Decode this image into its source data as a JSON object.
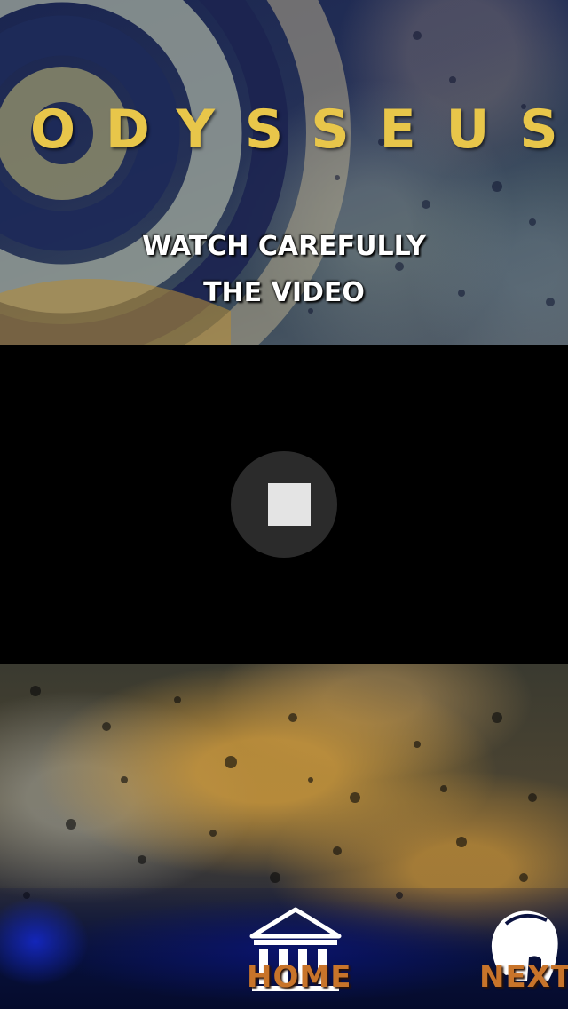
{
  "app": {
    "title": "ODYSSEUS"
  },
  "instruction": {
    "line1": "WATCH CAREFULLY",
    "line2": "THE VIDEO"
  },
  "video": {
    "control_icon": "stop-icon"
  },
  "nav": {
    "home_label": "HOME",
    "home_icon": "temple-icon",
    "next_label": "NEXT",
    "next_icon": "spartan-helmet-icon"
  },
  "colors": {
    "title_gold": "#e8c64a",
    "nav_label_orange": "#c8742a",
    "video_bg": "#000000",
    "stop_button_bg": "#2b2b2b"
  }
}
